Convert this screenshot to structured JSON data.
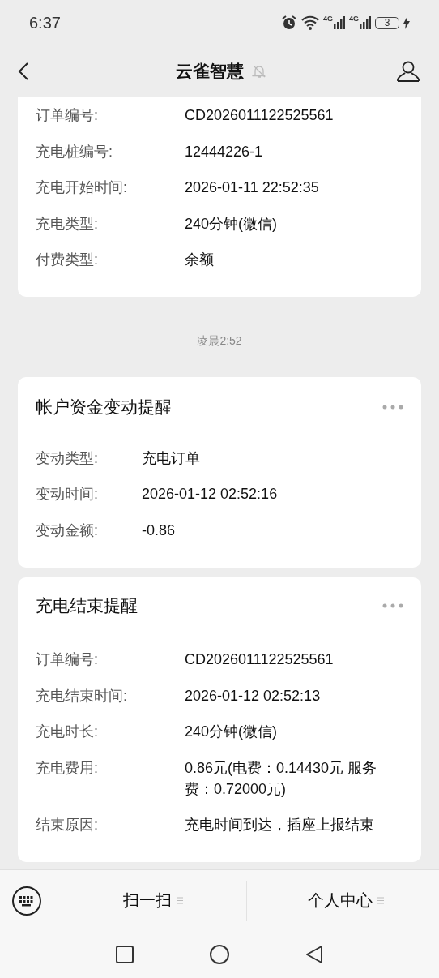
{
  "status_bar": {
    "time": "6:37",
    "network_1": "4G",
    "network_2": "4G",
    "battery": "3"
  },
  "header": {
    "title": "云雀智慧"
  },
  "messages": [
    {
      "kind": "card",
      "rows": [
        {
          "label": "订单编号:",
          "value": "CD2026011122525561"
        },
        {
          "label": "充电桩编号:",
          "value": "12444226-1"
        },
        {
          "label": "充电开始时间:",
          "value": "2026-01-11 22:52:35"
        },
        {
          "label": "充电类型:",
          "value": "240分钟(微信)"
        },
        {
          "label": "付费类型:",
          "value": "余额"
        }
      ]
    },
    {
      "kind": "time",
      "text": "凌晨2:52"
    },
    {
      "kind": "card",
      "title": "帐户资金变动提醒",
      "rows": [
        {
          "label": "变动类型:",
          "value": "充电订单"
        },
        {
          "label": "变动时间:",
          "value": "2026-01-12 02:52:16"
        },
        {
          "label": "变动金额:",
          "value": "-0.86"
        }
      ]
    },
    {
      "kind": "card",
      "title": "充电结束提醒",
      "rows": [
        {
          "label": "订单编号:",
          "value": "CD2026011122525561"
        },
        {
          "label": "充电结束时间:",
          "value": "2026-01-12 02:52:13"
        },
        {
          "label": "充电时长:",
          "value": "240分钟(微信)"
        },
        {
          "label": "充电费用:",
          "value": "0.86元(电费：0.14430元 服务费：0.72000元)"
        },
        {
          "label": "结束原因:",
          "value": "充电时间到达，插座上报结束"
        }
      ]
    }
  ],
  "menu_bar": {
    "items": [
      "扫一扫",
      "个人中心"
    ]
  }
}
